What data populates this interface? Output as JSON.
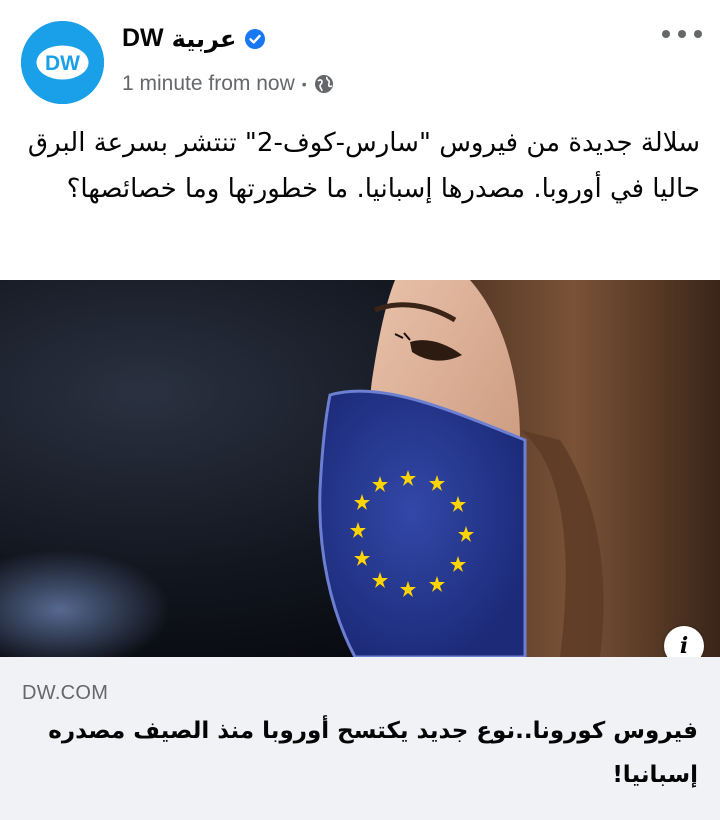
{
  "post": {
    "page_name_latin": "DW",
    "page_name_arabic": "عربية",
    "timestamp": "1 minute from now",
    "separator": "•",
    "text": "سلالة جديدة من فيروس \"سارس-كوف-2\" تنتشر بسرعة البرق حاليا في أوروبا. مصدرها إسبانيا. ما خطورتها وما خصائصها؟"
  },
  "avatar": {
    "label": "DW"
  },
  "icons": {
    "verified": "verified-badge-icon",
    "audience": "globe-icon",
    "more": "more-options-icon",
    "info": "info-icon"
  },
  "info": {
    "label": "i"
  },
  "link": {
    "domain": "DW.COM",
    "title": "فيروس كورونا..نوع جديد يكتسح أوروبا منذ الصيف مصدره إسبانيا!"
  },
  "colors": {
    "brand_blue": "#1aa0e8",
    "verified_blue": "#1877f2",
    "mask_blue": "#2a3fa0",
    "stars": "#ffd400"
  }
}
